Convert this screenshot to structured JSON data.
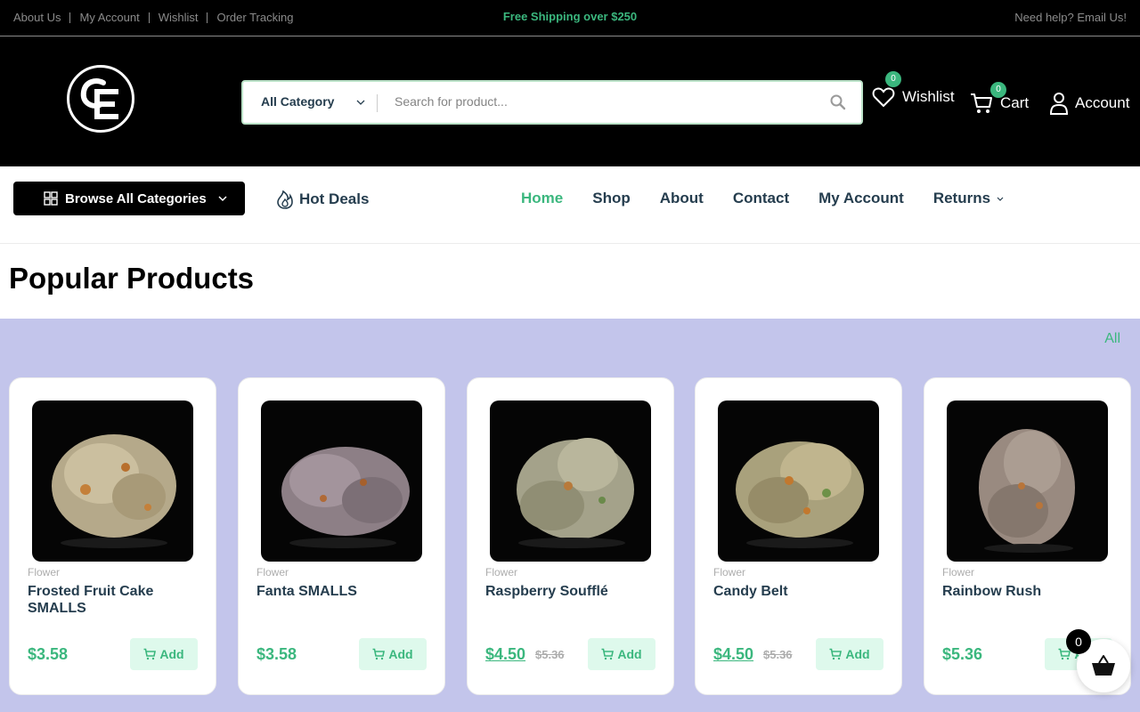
{
  "topbar": {
    "links": [
      "About Us",
      "My Account",
      "Wishlist",
      "Order Tracking"
    ],
    "promo": "Free Shipping over $250",
    "help": "Need help? Email Us!"
  },
  "header": {
    "logo_text": "CE",
    "category_select": "All Category",
    "search_placeholder": "Search for product...",
    "wishlist_label": "Wishlist",
    "wishlist_count": "0",
    "cart_label": "Cart",
    "cart_count": "0",
    "account_label": "Account"
  },
  "nav": {
    "browse_label": "Browse All Categories",
    "hot_deals_label": "Hot Deals",
    "menu": [
      {
        "label": "Home",
        "active": true
      },
      {
        "label": "Shop"
      },
      {
        "label": "About"
      },
      {
        "label": "Contact"
      },
      {
        "label": "My Account"
      },
      {
        "label": "Returns",
        "dropdown": true
      }
    ]
  },
  "section": {
    "title": "Popular Products",
    "filter_all": "All"
  },
  "products": [
    {
      "category": "Flower",
      "name": "Frosted Fruit Cake SMALLS",
      "price": "$3.58",
      "old_price": "",
      "add_label": "Add"
    },
    {
      "category": "Flower",
      "name": "Fanta SMALLS",
      "price": "$3.58",
      "old_price": "",
      "add_label": "Add"
    },
    {
      "category": "Flower",
      "name": "Raspberry Soufflé",
      "price": "$4.50",
      "old_price": "$5.36",
      "add_label": "Add"
    },
    {
      "category": "Flower",
      "name": "Candy Belt",
      "price": "$4.50",
      "old_price": "$5.36",
      "add_label": "Add"
    },
    {
      "category": "Flower",
      "name": "Rainbow Rush",
      "price": "$5.36",
      "old_price": "",
      "add_label": "Add"
    }
  ],
  "floating_cart": {
    "count": "0"
  },
  "colors": {
    "accent": "#3bb77e",
    "header_bg": "#000000",
    "products_bg": "#c3c5eb",
    "text": "#253d4e"
  }
}
